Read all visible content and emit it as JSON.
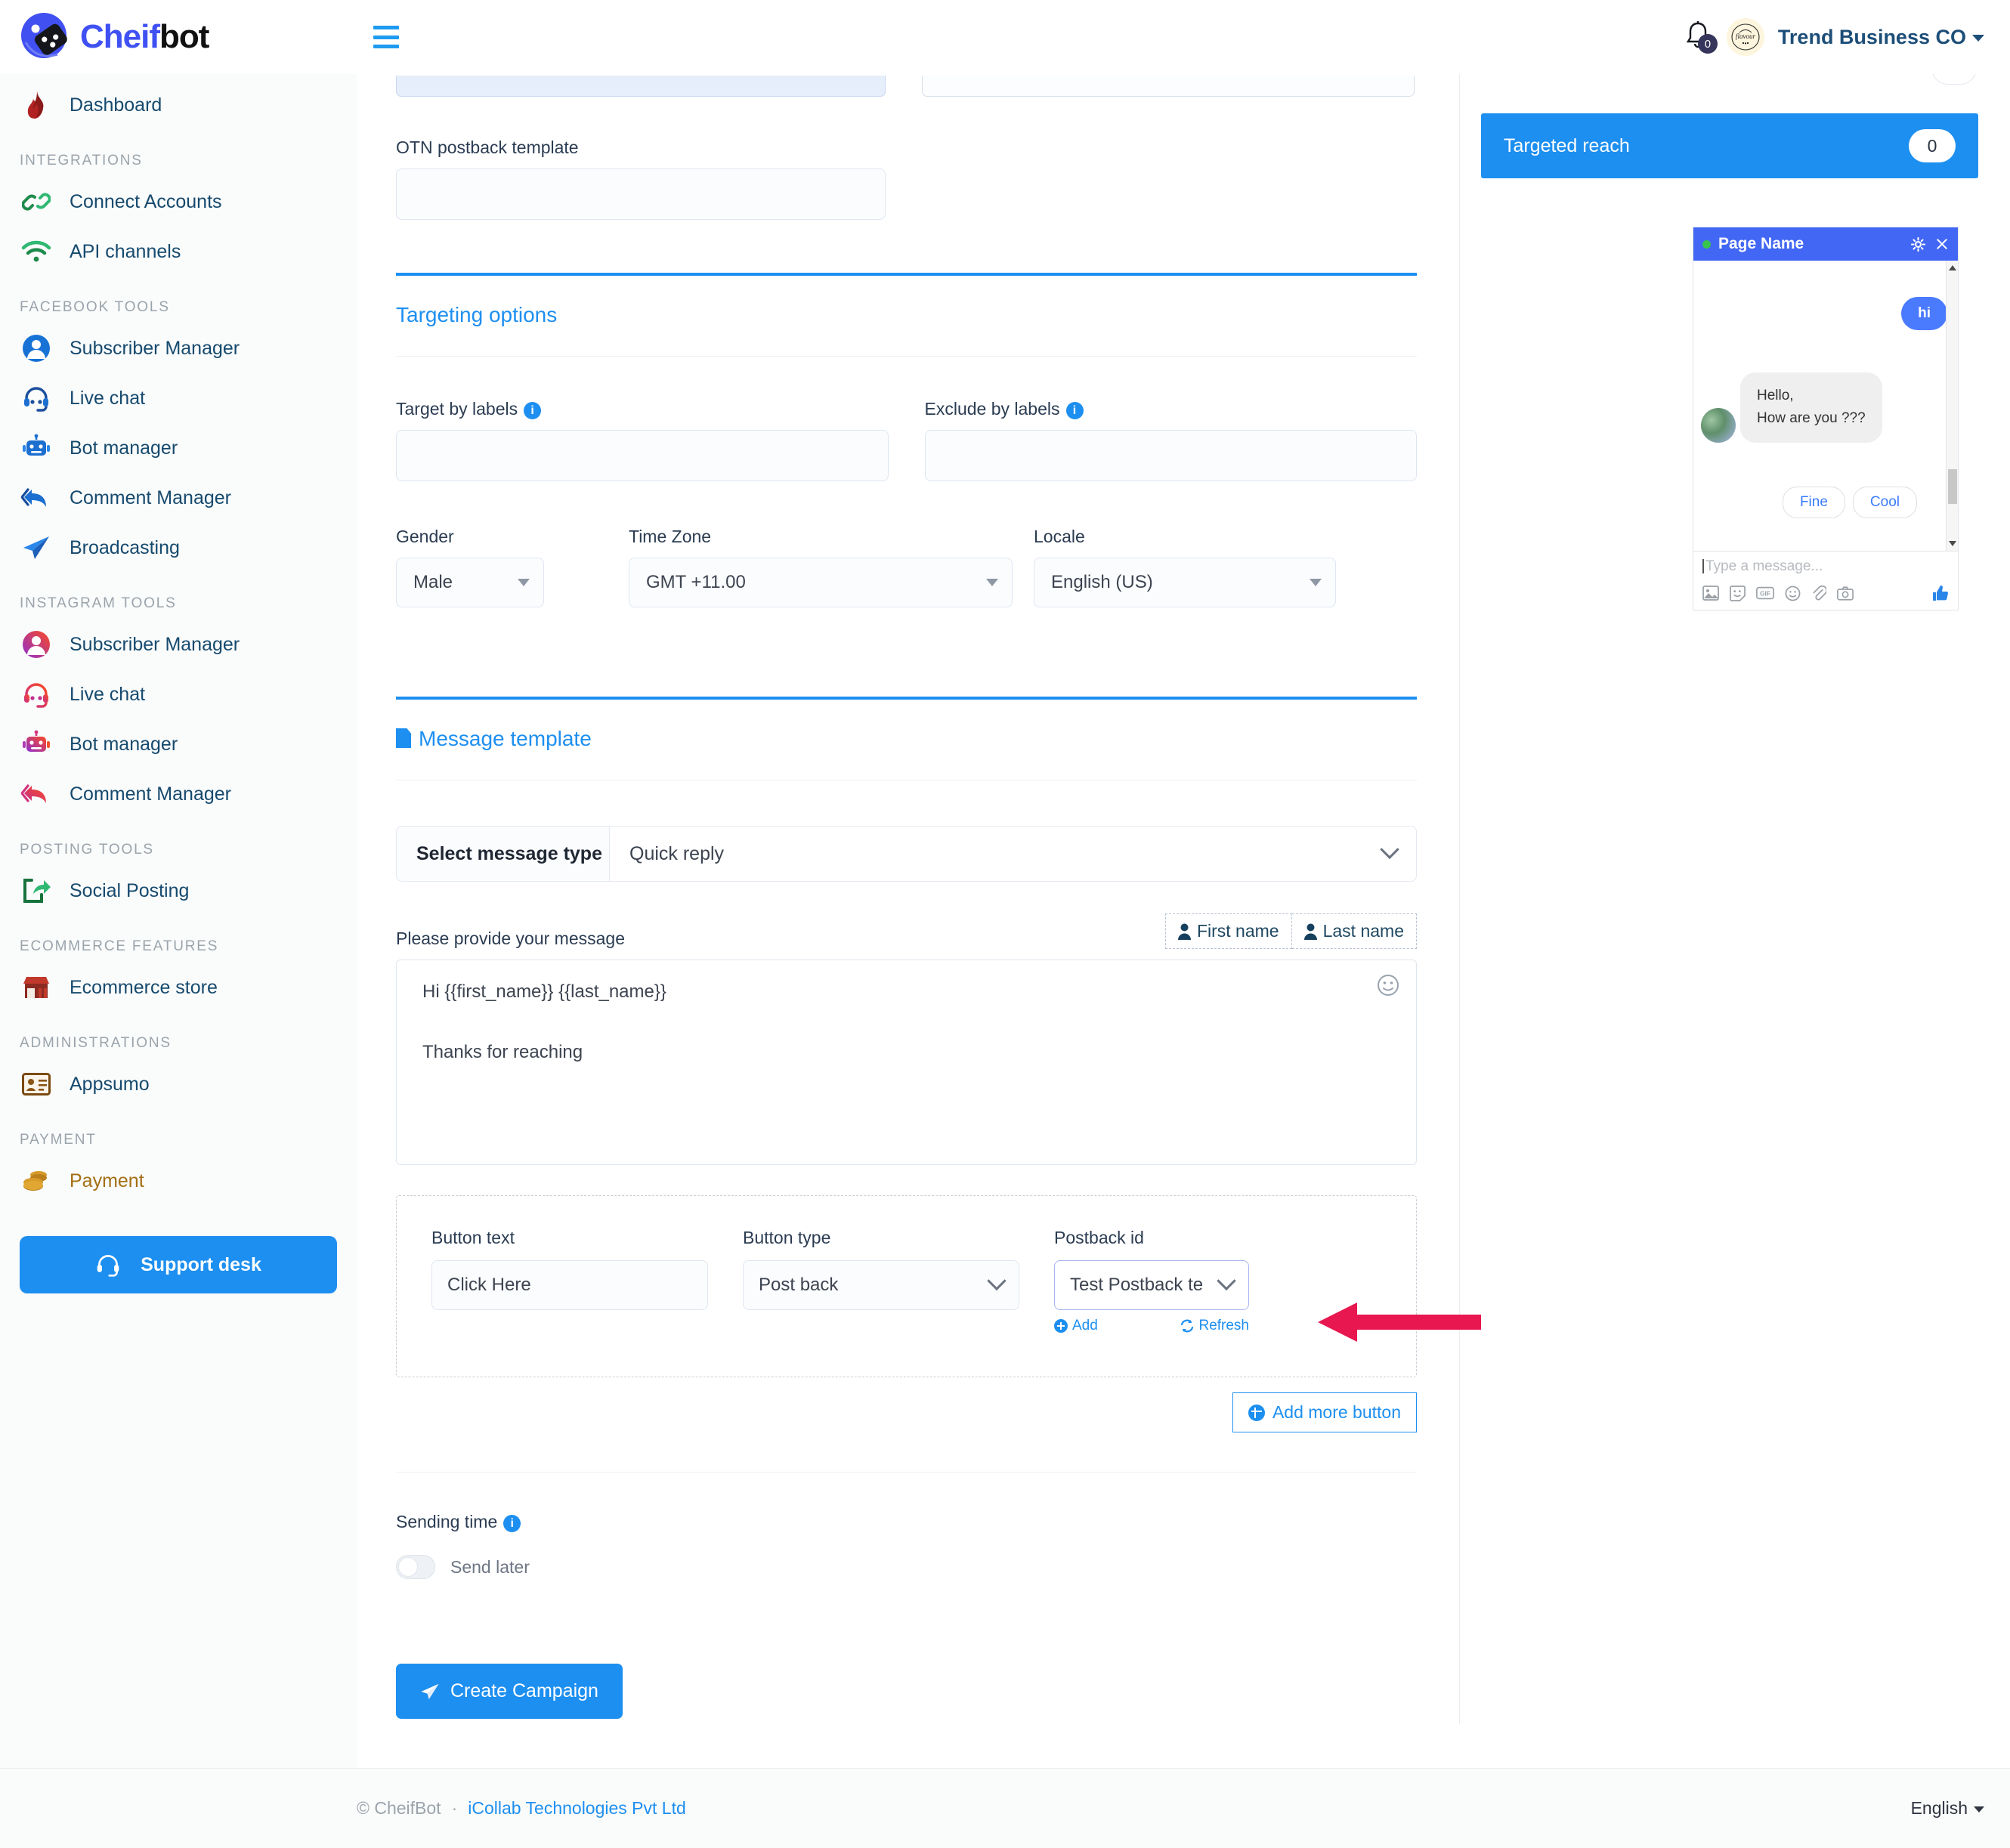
{
  "app": {
    "logo_text_a": "Cheif",
    "logo_text_b": "bot"
  },
  "header": {
    "notification_count": "0",
    "account_name": "Trend Business CO"
  },
  "sidebar": {
    "items": [
      {
        "label": "Dashboard",
        "icon": "flame-icon"
      }
    ],
    "sections": [
      {
        "title": "INTEGRATIONS",
        "items": [
          {
            "label": "Connect Accounts",
            "icon": "link-icon"
          },
          {
            "label": "API channels",
            "icon": "wifi-icon"
          }
        ]
      },
      {
        "title": "FACEBOOK TOOLS",
        "items": [
          {
            "label": "Subscriber Manager",
            "icon": "user-circle-icon"
          },
          {
            "label": "Live chat",
            "icon": "headset-icon"
          },
          {
            "label": "Bot manager",
            "icon": "robot-icon"
          },
          {
            "label": "Comment Manager",
            "icon": "reply-all-icon"
          },
          {
            "label": "Broadcasting",
            "icon": "paper-plane-icon"
          }
        ]
      },
      {
        "title": "INSTAGRAM TOOLS",
        "items": [
          {
            "label": "Subscriber Manager",
            "icon": "user-circle-icon"
          },
          {
            "label": "Live chat",
            "icon": "headset-icon"
          },
          {
            "label": "Bot manager",
            "icon": "robot-icon"
          },
          {
            "label": "Comment Manager",
            "icon": "reply-all-icon"
          }
        ]
      },
      {
        "title": "POSTING TOOLS",
        "items": [
          {
            "label": "Social Posting",
            "icon": "share-square-icon"
          }
        ]
      },
      {
        "title": "ECOMMERCE FEATURES",
        "items": [
          {
            "label": "Ecommerce store",
            "icon": "store-icon"
          }
        ]
      },
      {
        "title": "ADMINISTRATIONS",
        "items": [
          {
            "label": "Appsumo",
            "icon": "id-card-icon"
          }
        ]
      },
      {
        "title": "PAYMENT",
        "items": [
          {
            "label": "Payment",
            "icon": "coins-icon"
          }
        ]
      }
    ],
    "support_button": "Support desk"
  },
  "form": {
    "otn_postback_label": "OTN postback template",
    "otn_postback_value": "",
    "targeting": {
      "heading": "Targeting options",
      "target_by_labels_label": "Target by labels",
      "target_by_labels_value": "",
      "exclude_by_labels_label": "Exclude by labels",
      "exclude_by_labels_value": "",
      "gender_label": "Gender",
      "gender_value": "Male",
      "timezone_label": "Time Zone",
      "timezone_value": "GMT +11.00",
      "locale_label": "Locale",
      "locale_value": "English (US)"
    },
    "message_template": {
      "heading": "Message template",
      "select_message_type_label": "Select message type",
      "select_message_type_value": "Quick reply",
      "message_label": "Please provide your message",
      "first_name_chip": "First name",
      "last_name_chip": "Last name",
      "message_line_1": "Hi  {{first_name}} {{last_name}}",
      "message_line_2": "Thanks for reaching",
      "button_text_label": "Button text",
      "button_text_value": "Click Here",
      "button_type_label": "Button type",
      "button_type_value": "Post back",
      "postback_id_label": "Postback id",
      "postback_id_value": "Test Postback te",
      "add_link": "Add",
      "refresh_link": "Refresh",
      "add_more_button": "Add more button"
    },
    "sending_time_label": "Sending time",
    "send_later_label": "Send later",
    "create_campaign_button": "Create Campaign"
  },
  "right_panel": {
    "targeted_reach_label": "Targeted reach",
    "targeted_reach_value": "0",
    "chat_preview": {
      "page_name": "Page Name",
      "outgoing_message": "hi",
      "incoming_line_1": "Hello,",
      "incoming_line_2": "How are you  ???",
      "quick_replies": [
        "Fine",
        "Cool"
      ],
      "input_placeholder": "Type a message..."
    }
  },
  "footer": {
    "copyright": "© CheifBot",
    "separator": "·",
    "company": "iCollab Technologies Pvt Ltd",
    "language": "English"
  },
  "colors": {
    "accent": "#1d8ff0",
    "messenger_blue": "#4267f4",
    "arrow": "#e8174f",
    "sidebar_text": "#164a6e"
  }
}
